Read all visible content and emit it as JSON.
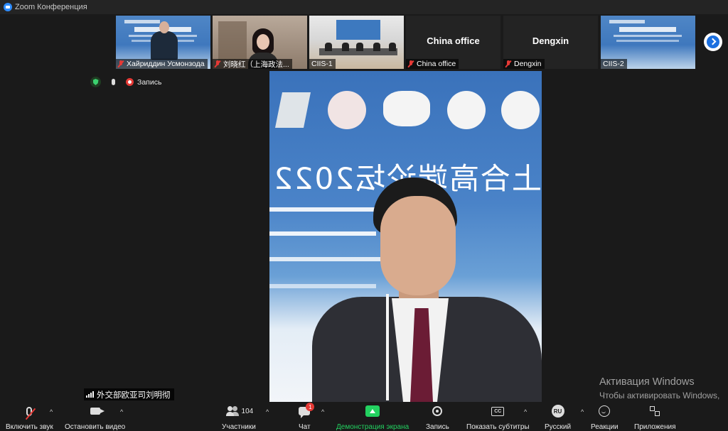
{
  "window": {
    "title": "Zoom Конференция"
  },
  "thumbnails": [
    {
      "name": "Хайриддин Усмонзода",
      "muted": true
    },
    {
      "name": "刘晓红（上海政法...",
      "muted": true
    },
    {
      "name": "CIIS-1",
      "muted": false
    },
    {
      "name": "China office",
      "label": "China office",
      "muted": true
    },
    {
      "name": "Dengxin",
      "label": "Dengxin",
      "muted": true
    },
    {
      "name": "CIIS-2",
      "muted": false
    }
  ],
  "status": {
    "recording_label": "Запись"
  },
  "main_video": {
    "speaker_name": "外交部欧亚司刘明彻",
    "banner_text": "上合高端论坛2022"
  },
  "toolbar": {
    "audio_label": "Включить звук",
    "video_label": "Остановить видео",
    "participants_label": "Участники",
    "participants_count": "104",
    "chat_label": "Чат",
    "chat_badge": "1",
    "share_label": "Демонстрация экрана",
    "record_label": "Запись",
    "captions_label": "Показать субтитры",
    "captions_icon": "CC",
    "language_label": "Русский",
    "language_icon": "RU",
    "reactions_label": "Реакции",
    "apps_label": "Приложения"
  },
  "watermark": {
    "title": "Активация Windows",
    "text": "Чтобы активировать Windows, перейдите в раздел \"Параметры\"."
  },
  "colors": {
    "share_green": "#23d160",
    "mute_red": "#e53935",
    "accent_blue": "#1a6fe0"
  }
}
